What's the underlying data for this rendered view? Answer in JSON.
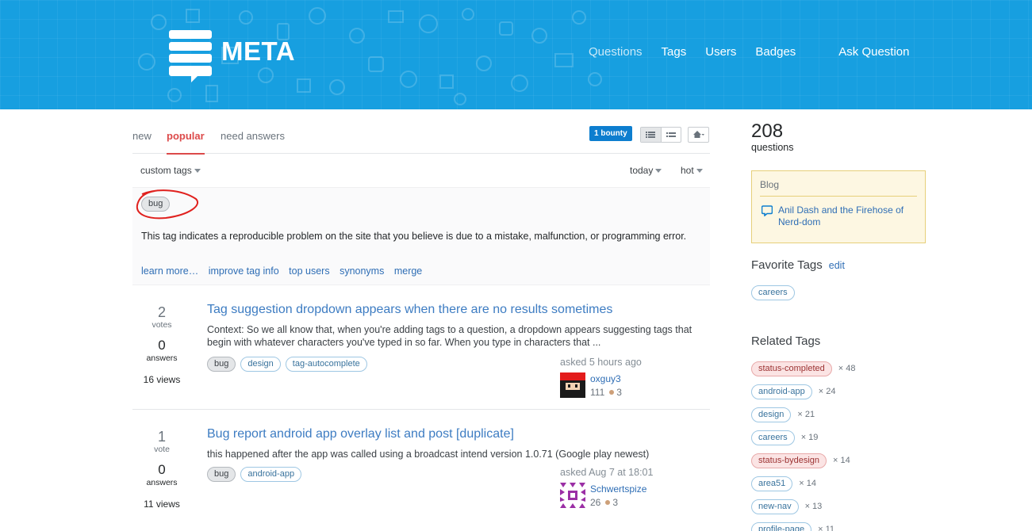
{
  "header": {
    "logo_text": "META",
    "nav": [
      {
        "label": "Questions",
        "current": true
      },
      {
        "label": "Tags",
        "current": false
      },
      {
        "label": "Users",
        "current": false
      },
      {
        "label": "Badges",
        "current": false
      }
    ],
    "ask_label": "Ask Question"
  },
  "tabs": {
    "items": [
      "new",
      "popular",
      "need answers"
    ],
    "active": "popular",
    "bounty_label": "1 bounty"
  },
  "filters": {
    "custom_tags": "custom tags",
    "period": "today",
    "sort": "hot"
  },
  "tag_info": {
    "tag": "bug",
    "excerpt": "This tag indicates a reproducible problem on the site that you believe is due to a mistake, malfunction, or programming error.",
    "links": [
      "learn more…",
      "improve tag info",
      "top users",
      "synonyms",
      "merge"
    ]
  },
  "questions": [
    {
      "votes": "2",
      "votes_label": "votes",
      "answers": "0",
      "answers_label": "answers",
      "views": "16 views",
      "title": "Tag suggestion dropdown appears when there are no results sometimes",
      "excerpt": "Context: So we all know that, when you're adding tags to a question, a dropdown appears suggesting tags that begin with whatever characters you've typed in so far. When you type in characters that ...",
      "tags": [
        "bug",
        "design",
        "tag-autocomplete"
      ],
      "asked": "asked 5 hours ago",
      "user": "oxguy3",
      "rep": "111",
      "bronze": "3"
    },
    {
      "votes": "1",
      "votes_label": "vote",
      "answers": "0",
      "answers_label": "answers",
      "views": "11 views",
      "title": "Bug report android app overlay list and post [duplicate]",
      "excerpt": "this happened after the app was called using a broadcast intend version 1.0.71 (Google play newest)",
      "tags": [
        "bug",
        "android-app"
      ],
      "asked": "asked Aug 7 at 18:01",
      "user": "Schwertspize",
      "rep": "26",
      "bronze": "3"
    }
  ],
  "sidebar": {
    "count": "208",
    "count_label": "questions",
    "blog_title": "Blog",
    "blog_link": "Anil Dash and the Firehose of Nerd-dom",
    "favorite_title": "Favorite Tags",
    "favorite_edit": "edit",
    "favorite_tags": [
      "careers"
    ],
    "related_title": "Related Tags",
    "related": [
      {
        "tag": "status-completed",
        "count": "× 48",
        "style": "red"
      },
      {
        "tag": "android-app",
        "count": "× 24",
        "style": "normal"
      },
      {
        "tag": "design",
        "count": "× 21",
        "style": "normal"
      },
      {
        "tag": "careers",
        "count": "× 19",
        "style": "normal"
      },
      {
        "tag": "status-bydesign",
        "count": "× 14",
        "style": "red"
      },
      {
        "tag": "area51",
        "count": "× 14",
        "style": "normal"
      },
      {
        "tag": "new-nav",
        "count": "× 13",
        "style": "normal"
      },
      {
        "tag": "profile-page",
        "count": "× 11",
        "style": "normal"
      }
    ]
  },
  "colors": {
    "header_bg": "#179fe0",
    "link": "#3d7cc2",
    "active_tab": "#dc4a4a",
    "bounty": "#0d7ecf"
  }
}
